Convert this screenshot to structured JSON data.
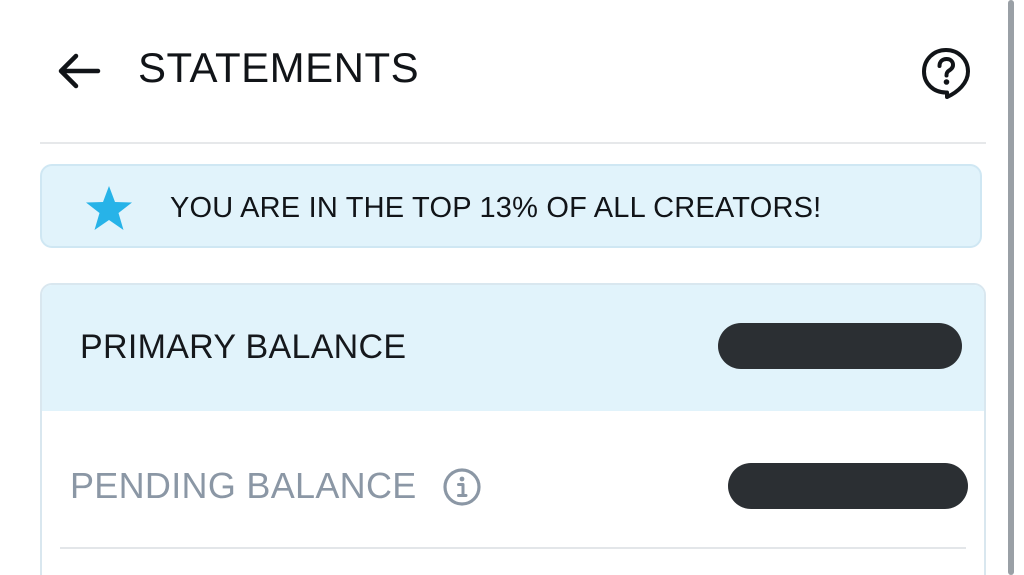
{
  "header": {
    "title": "STATEMENTS",
    "back_icon": "arrow-left-icon",
    "help_icon": "question-bubble-icon"
  },
  "banner": {
    "icon": "star-icon",
    "text": "YOU ARE IN THE TOP 13% OF ALL CREATORS!"
  },
  "balances": {
    "primary_label": "PRIMARY BALANCE",
    "pending_label": "PENDING BALANCE",
    "pending_info_icon": "info-icon"
  },
  "colors": {
    "accent": "#27b3e8",
    "banner_bg": "#e1f3fb",
    "muted_text": "#8b97a5",
    "redaction": "#2b2f33"
  }
}
